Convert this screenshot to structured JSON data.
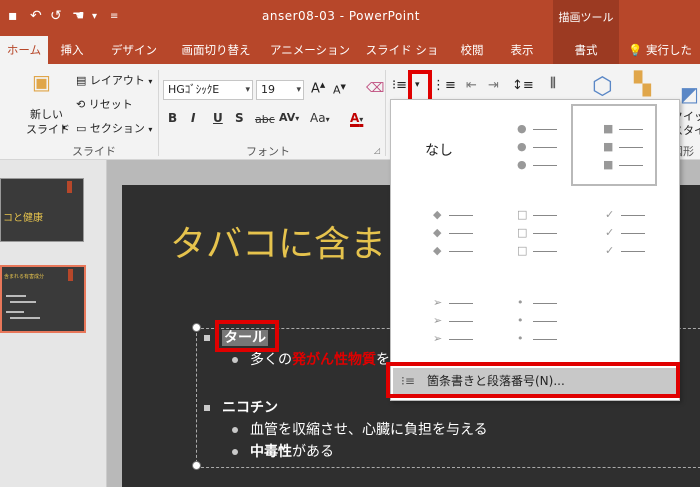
{
  "window": {
    "title": "anser08-03 - PowerPoint",
    "context_tab_group": "描画ツール"
  },
  "tabs": [
    {
      "label": "ホーム",
      "active": true
    },
    {
      "label": "挿入"
    },
    {
      "label": "デザイン"
    },
    {
      "label": "画面切り替え"
    },
    {
      "label": "アニメーション"
    },
    {
      "label": "スライド ショー"
    },
    {
      "label": "校閲"
    },
    {
      "label": "表示"
    },
    {
      "label": "書式",
      "context": true
    },
    {
      "label": "実行したい"
    }
  ],
  "ribbon": {
    "slides_group": {
      "new_slide_line1": "新しい",
      "new_slide_line2": "スライド",
      "layout": "レイアウト",
      "reset": "リセット",
      "section": "セクション",
      "label": "スライド"
    },
    "font_group": {
      "font_name": "HGｺﾞｼｯｸE",
      "font_size": "19",
      "grow": "A",
      "shrink": "A",
      "bold": "B",
      "italic": "I",
      "underline": "U",
      "shadow": "S",
      "strike": "abc",
      "spacing": "AV",
      "case": "Aa",
      "color": "A",
      "label": "フォント"
    },
    "right_partial": {
      "quick_line1": "クイッ",
      "quick_line2": "スタイル",
      "group_label": "図形"
    }
  },
  "slide": {
    "title": "タバコに含ま",
    "items": [
      {
        "text": "タール",
        "level": 1
      },
      {
        "text_pre": "多くの",
        "text_red": "発がん性物質",
        "text_post": "を",
        "level": 2
      },
      {
        "text": "ニコチン",
        "level": 1
      },
      {
        "text": "血管を収縮させ、心臓に負担を与える",
        "level": 2
      },
      {
        "text_bold": "中毒性",
        "text_post": "がある",
        "level": 2
      }
    ]
  },
  "thumbnails": [
    {
      "caption": "コと健康"
    },
    {
      "caption": "含まれる有害成分"
    }
  ],
  "bullet_gallery": {
    "none_label": "なし",
    "styles": [
      {
        "name": "none",
        "icon": "none"
      },
      {
        "name": "filled-round",
        "icon": "●"
      },
      {
        "name": "filled-square",
        "icon": "■",
        "selected": true
      },
      {
        "name": "diamond",
        "icon": "◆"
      },
      {
        "name": "hollow-square",
        "icon": "□"
      },
      {
        "name": "checkmark",
        "icon": "✓"
      },
      {
        "name": "arrow",
        "icon": "➢"
      },
      {
        "name": "small-dot",
        "icon": "•"
      }
    ],
    "menu_item": "箇条書きと段落番号(N)..."
  },
  "colors": {
    "accent": "#b7472a",
    "highlight_red": "#e00000",
    "slide_title": "#e6c34d",
    "slide_bg": "#2f2f2f"
  }
}
